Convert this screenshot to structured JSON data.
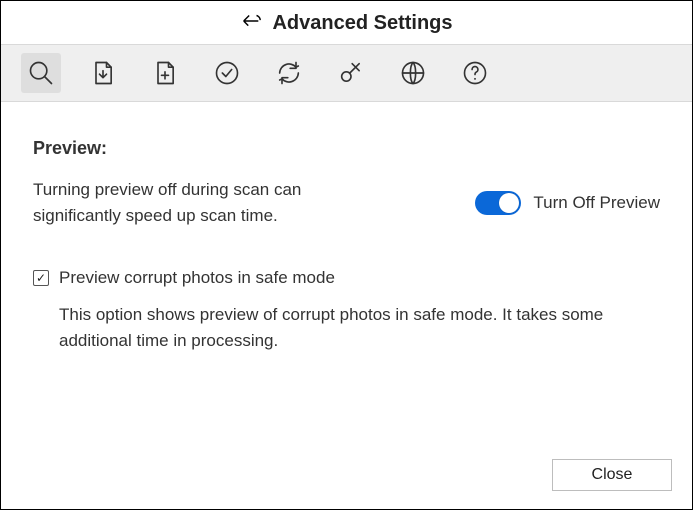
{
  "header": {
    "title": "Advanced Settings"
  },
  "toolbar": {
    "icons": [
      "search",
      "doc-down",
      "doc-add",
      "check-circle",
      "refresh",
      "key",
      "globe",
      "help"
    ]
  },
  "preview": {
    "section_title": "Preview:",
    "scan_desc": "Turning preview off during scan can significantly speed up scan time.",
    "toggle_label": "Turn Off Preview",
    "toggle_on": true,
    "safe_mode_checked": true,
    "safe_mode_label": "Preview corrupt photos in safe mode",
    "safe_mode_desc": "This option shows preview of corrupt photos in safe mode. It takes some additional time in processing."
  },
  "footer": {
    "close_label": "Close"
  }
}
